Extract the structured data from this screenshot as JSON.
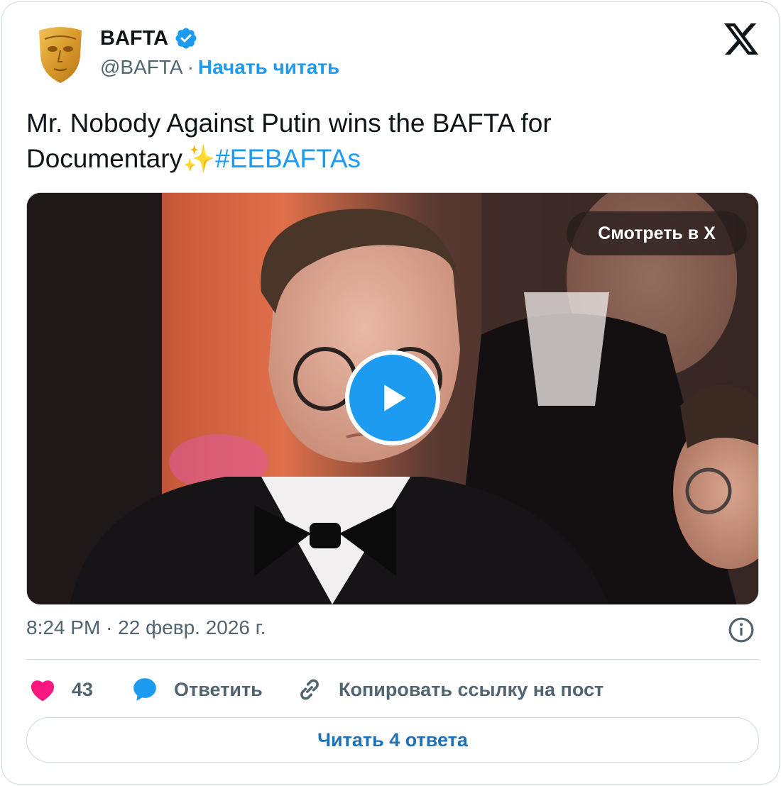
{
  "account": {
    "name": "BAFTA",
    "handle": "@BAFTA",
    "separator": "·",
    "follow_label": "Начать читать",
    "avatar_icon": "bafta-mask-logo",
    "verified_icon": "verified-badge-icon"
  },
  "brand": {
    "logo_icon": "x-logo-icon"
  },
  "tweet": {
    "text": "Mr. Nobody Against Putin wins the BAFTA for Documentary",
    "emoji": "✨",
    "hashtag": "#EEBAFTAs"
  },
  "media": {
    "watch_label": "Смотреть в X",
    "play_icon": "play-icon"
  },
  "meta": {
    "time": "8:24 PM",
    "separator": "·",
    "date": "22 февр. 2026 г.",
    "info_icon": "info-icon"
  },
  "actions": {
    "like_count": "43",
    "reply_label": "Ответить",
    "copy_label": "Копировать ссылку на пост"
  },
  "footer": {
    "read_replies_label": "Читать 4 ответа"
  },
  "colors": {
    "accent": "#1d9bf0",
    "like": "#f91880",
    "secondary_text": "#536471",
    "border": "#cfd9de"
  }
}
